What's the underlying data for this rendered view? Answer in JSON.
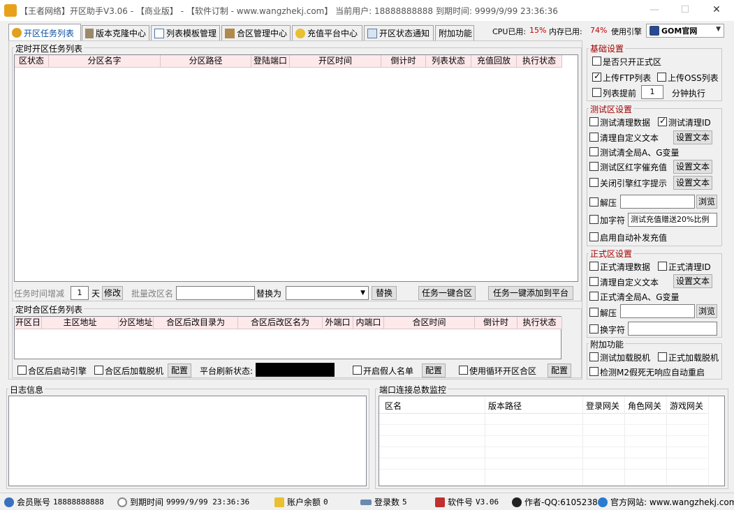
{
  "window": {
    "title": "【王者网络】开区助手V3.06 - 【商业版】 - 【软件订制 - www.wangzhekj.com】 当前用户: 18888888888 到期时间: 9999/9/99 23:36:36",
    "minimize": "—",
    "maximize": "☐",
    "close": "✕"
  },
  "tabs": [
    {
      "label": "开区任务列表",
      "icon": "clock-icon",
      "color": "#e0a020"
    },
    {
      "label": "版本克隆中心",
      "icon": "clone-icon",
      "color": "#7a6a4a"
    },
    {
      "label": "列表模板管理",
      "icon": "list-icon",
      "color": "#4a78b0"
    },
    {
      "label": "合区管理中心",
      "icon": "merge-icon",
      "color": "#8a6a3a"
    },
    {
      "label": "充值平台中心",
      "icon": "coin-icon",
      "color": "#e0b020"
    },
    {
      "label": "开区状态通知",
      "icon": "notify-icon",
      "color": "#5a7aa0"
    },
    {
      "label": "附加功能",
      "icon": "",
      "color": ""
    }
  ],
  "system": {
    "cpu_label": "CPU已用:",
    "cpu_value": "15%",
    "mem_label": "内存已用:",
    "mem_value": "74%",
    "engine_label": "使用引擎",
    "engine_value": "GOM官网"
  },
  "open_tasks": {
    "title": "定时开区任务列表",
    "columns": [
      "区状态",
      "分区名字",
      "分区路径",
      "登陆端口",
      "开区时间",
      "倒计时",
      "列表状态",
      "充值回放",
      "执行状态"
    ],
    "time_adjust_label": "任务时间增减",
    "time_adjust_value": "1",
    "day_unit": "天",
    "modify_button": "修改",
    "batch_rename_label": "批量改区名",
    "batch_rename_value": "",
    "replace_label": "替换为",
    "replace_value": "",
    "replace_button": "替换",
    "one_click_merge_button": "任务一键合区",
    "one_click_add_platform_button": "任务一键添加到平台"
  },
  "merge_tasks": {
    "title": "定时合区任务列表",
    "columns": [
      "开区日",
      "主区地址",
      "分区地址",
      "合区后改目录为",
      "合区后改区名为",
      "外端口",
      "内端口",
      "合区时间",
      "倒计时",
      "执行状态"
    ],
    "start_engine_after_merge": "合区后启动引擎",
    "load_offline_after_merge": "合区后加载脱机",
    "config_button": "配置",
    "platform_refresh_label": "平台刷新状态:",
    "platform_refresh_value": "",
    "fake_list_label": "开启假人名单",
    "fake_config_button": "配置",
    "loop_merge_label": "使用循环开区合区",
    "loop_config_button": "配置"
  },
  "basic_settings": {
    "title": "基础设置",
    "only_official": "是否只开正式区",
    "upload_ftp": "上传FTP列表",
    "upload_oss": "上传OSS列表",
    "list_advance": "列表提前",
    "advance_minutes": "1",
    "minute_exec": "分钟执行"
  },
  "test_settings": {
    "title": "测试区设置",
    "clean_data": "测试清理数据",
    "clean_id": "测试清理ID",
    "clean_custom_text": "清理自定义文本",
    "set_text_button": "设置文本",
    "clean_global_vars": "测试清全局A、G变量",
    "red_text_recharge": "测试区红字催充值",
    "close_engine_red_text": "关闭引擎红字提示",
    "unzip": "解压",
    "unzip_path": "",
    "browse_button": "浏览",
    "add_char": "加字符",
    "add_char_value": "测试充值赠送20%比例",
    "auto_recharge": "启用自动补发充值"
  },
  "official_settings": {
    "title": "正式区设置",
    "clean_data": "正式清理数据",
    "clean_id": "正式清理ID",
    "clean_custom_text": "清理自定义文本",
    "set_text_button": "设置文本",
    "clean_global_vars": "正式清全局A、G变量",
    "unzip": "解压",
    "unzip_path": "",
    "browse_button": "浏览",
    "replace_char": "换字符",
    "replace_char_value": ""
  },
  "addons": {
    "title": "附加功能",
    "test_load_offline": "测试加载脱机",
    "official_load_offline": "正式加载脱机",
    "detect_m2_restart": "检测M2假死无响应自动重启"
  },
  "log": {
    "title": "日志信息"
  },
  "port_monitor": {
    "title": "端口连接总数监控",
    "columns": [
      "区名",
      "版本路径",
      "登录网关",
      "角色网关",
      "游戏网关"
    ]
  },
  "statusbar": {
    "member_label": "会员账号",
    "member_value": "18888888888",
    "expire_label": "到期时间",
    "expire_value": "9999/9/99 23:36:36",
    "balance_label": "账户余额",
    "balance_value": "0",
    "login_count_label": "登录数",
    "login_count_value": "5",
    "software_no_label": "软件号",
    "software_no_value": "V3.06",
    "author": "作者-QQ:6105238",
    "website": "官方网站: www.wangzhekj.com"
  }
}
